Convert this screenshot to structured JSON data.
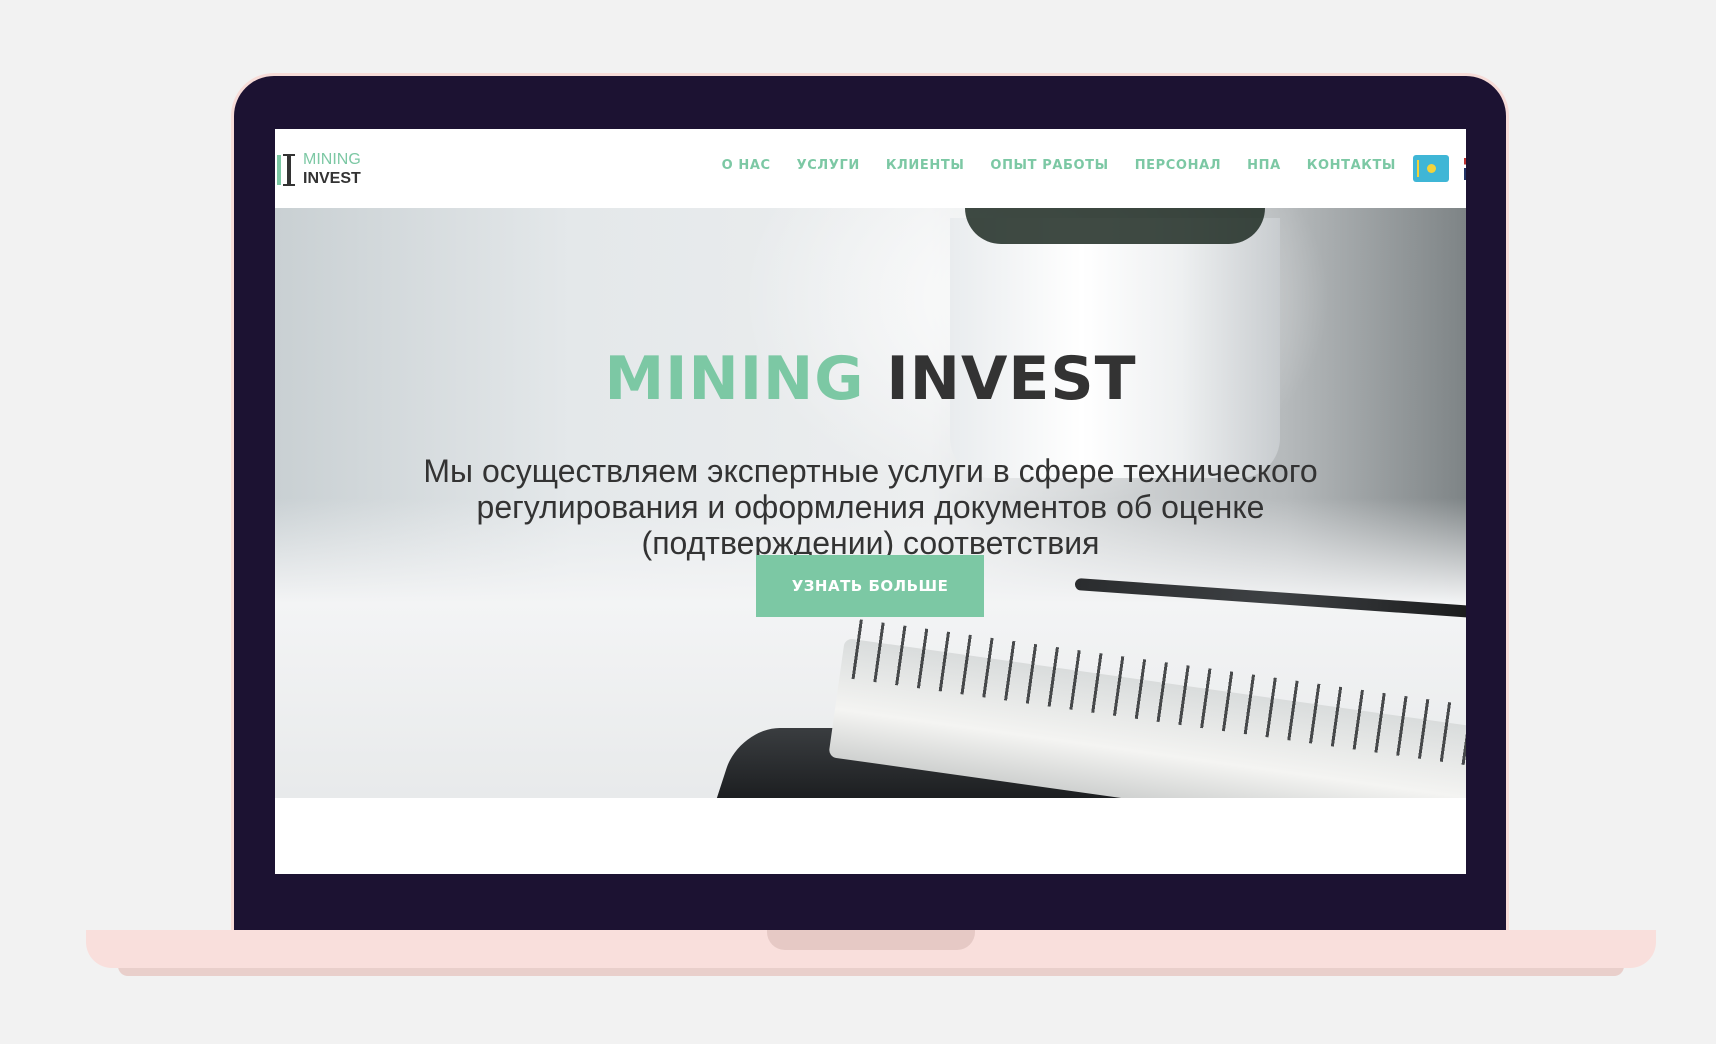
{
  "logo": {
    "line1": "MINING",
    "line2": "INVEST"
  },
  "nav": {
    "items": [
      "О НАС",
      "УСЛУГИ",
      "КЛИЕНТЫ",
      "ОПЫТ РАБОТЫ",
      "ПЕРСОНАЛ",
      "НПА",
      "КОНТАКТЫ"
    ]
  },
  "hero": {
    "title_part1": "MINING",
    "title_part2": "INVEST",
    "subtitle": "Мы осуществляем экспертные услуги в сфере технического регулирования и оформления документов об оценке (подтверждении) соответствия",
    "button_label": "УЗНАТЬ БОЛЬШЕ"
  },
  "language": {
    "current_flag": "kz-flag-icon",
    "secondary_flag": "uk-flag-icon"
  },
  "colors": {
    "accent": "#7cc8a4",
    "dark_text": "#333333",
    "laptop_bezel": "#1c1232",
    "laptop_base": "#f9dfdc",
    "background": "#f2f2f2"
  }
}
